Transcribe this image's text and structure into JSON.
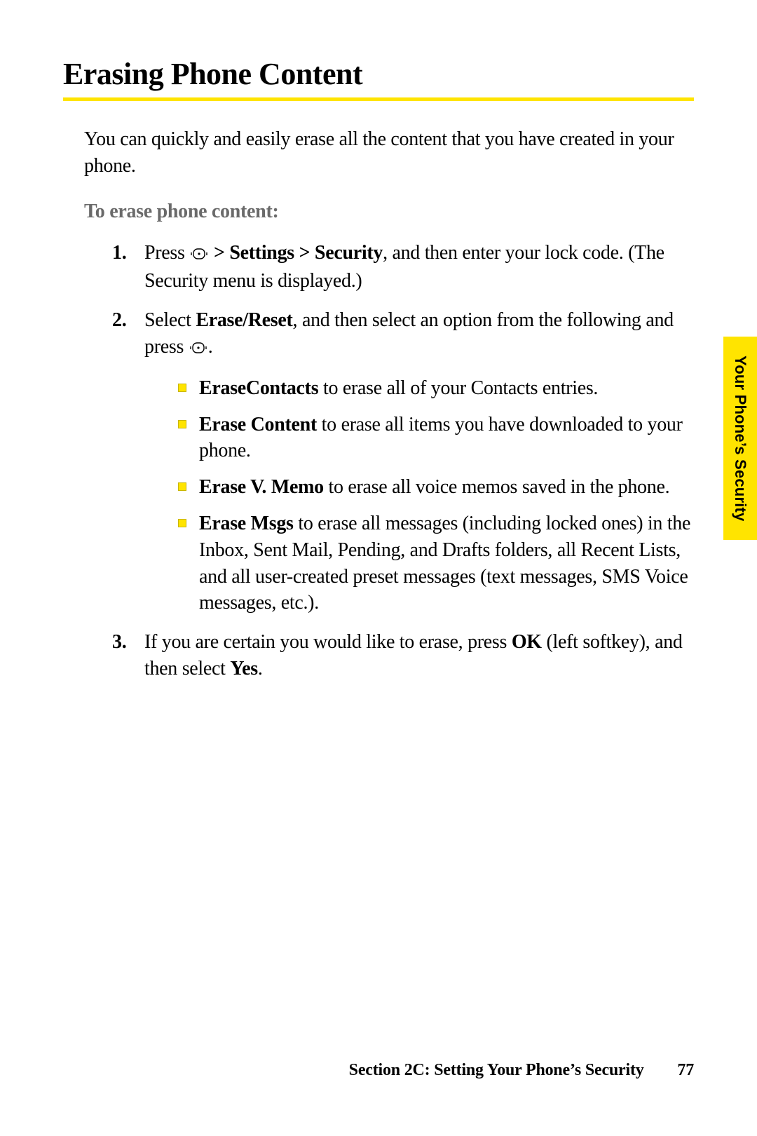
{
  "heading": "Erasing Phone Content",
  "intro": "You can quickly and easily erase all the content that you have created in your phone.",
  "subheading": "To erase phone content:",
  "steps": {
    "s1": {
      "num": "1.",
      "pre": "Press ",
      "bold": " > Settings > Security",
      "post": ", and then enter your lock code. (The Security menu is displayed.)"
    },
    "s2": {
      "num": "2.",
      "pre": "Select ",
      "bold": "Erase/Reset",
      "mid": ", and then select an option from the following and press ",
      "post": "."
    },
    "s3": {
      "num": "3.",
      "pre": "If you are certain you would like to erase, press ",
      "bold1": "OK",
      "mid": " (left softkey), and then select ",
      "bold2": "Yes",
      "post": "."
    }
  },
  "sub": {
    "a": {
      "bold": "EraseContacts",
      "rest": " to erase all of your Contacts entries."
    },
    "b": {
      "bold": "Erase Content",
      "rest": " to erase all items you have downloaded to your phone."
    },
    "c": {
      "bold": "Erase V. Memo",
      "rest": " to erase all voice memos saved in the phone."
    },
    "d": {
      "bold": "Erase Msgs",
      "rest": " to erase all messages (including locked ones) in the Inbox, Sent Mail, Pending, and Drafts folders, all Recent Lists, and all user-created preset messages (text messages, SMS Voice messages, etc.)."
    }
  },
  "sideTab": "Your Phone’s Security",
  "footer": {
    "section": "Section 2C: Setting Your Phone’s Security",
    "page": "77"
  }
}
